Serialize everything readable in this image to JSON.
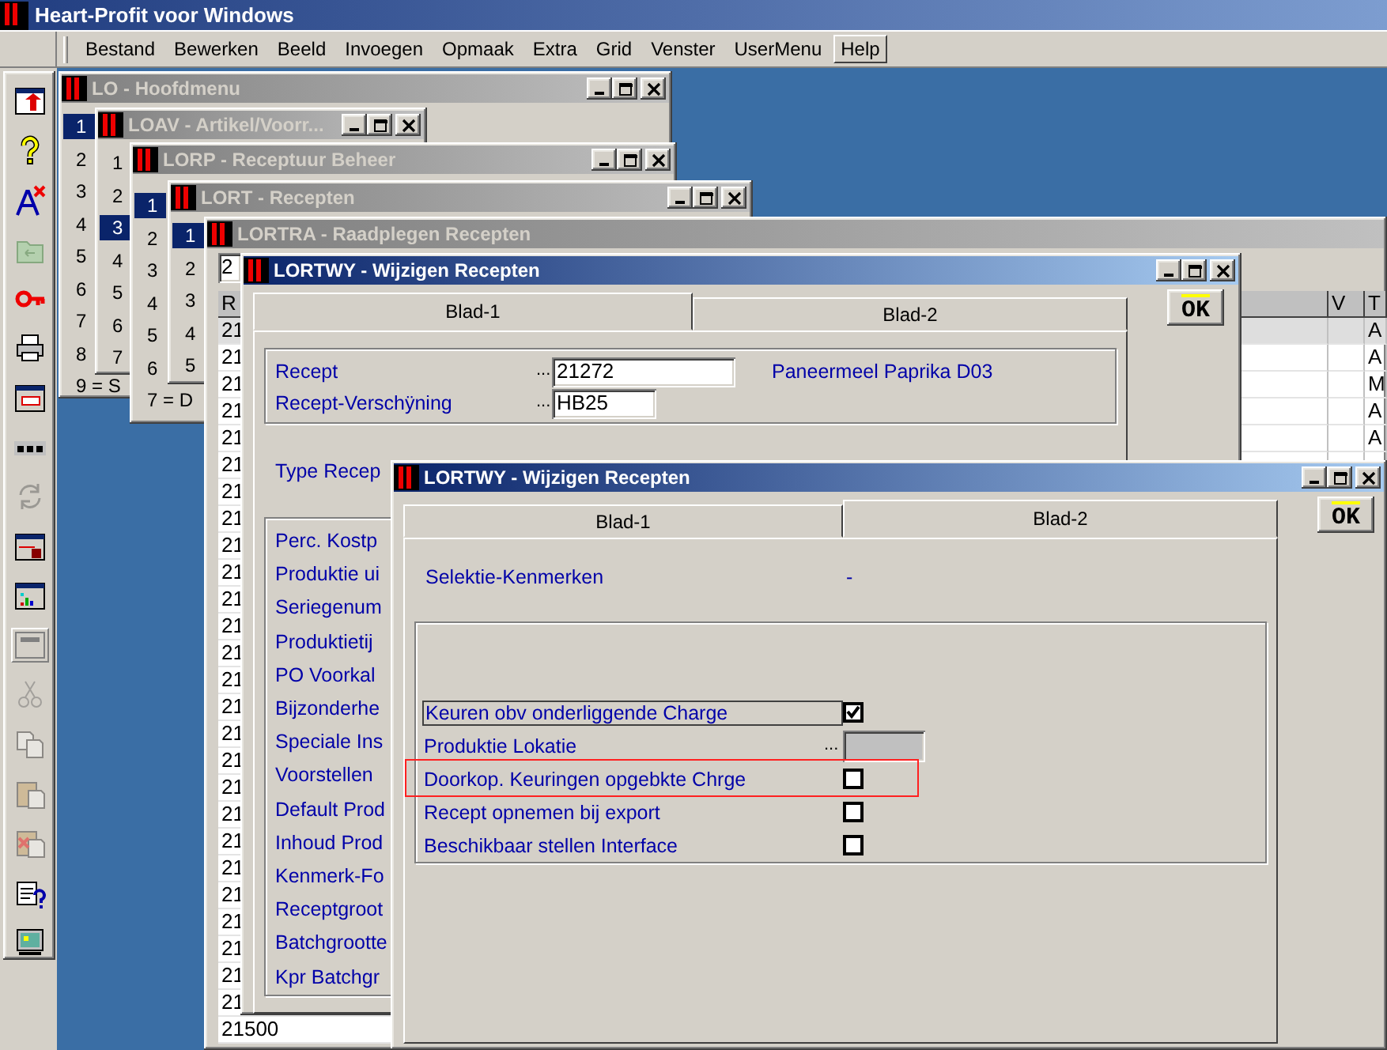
{
  "app_title": "Heart-Profit voor Windows",
  "menu": [
    {
      "label": "Bestand",
      "selected": false
    },
    {
      "label": "Bewerken",
      "selected": false
    },
    {
      "label": "Beeld",
      "selected": false
    },
    {
      "label": "Invoegen",
      "selected": false
    },
    {
      "label": "Opmaak",
      "selected": false
    },
    {
      "label": "Extra",
      "selected": false
    },
    {
      "label": "Grid",
      "selected": false
    },
    {
      "label": "Venster",
      "selected": false
    },
    {
      "label": "UserMenu",
      "selected": false
    },
    {
      "label": "Help",
      "selected": true
    }
  ],
  "toolbar": [
    {
      "disabled": false,
      "pressed": false
    },
    {
      "disabled": false,
      "pressed": false
    },
    {
      "disabled": false,
      "pressed": false
    },
    {
      "disabled": true,
      "pressed": false
    },
    {
      "disabled": false,
      "pressed": false
    },
    {
      "disabled": false,
      "pressed": false
    },
    {
      "disabled": false,
      "pressed": false
    },
    {
      "disabled": false,
      "pressed": false
    },
    {
      "disabled": true,
      "pressed": false
    },
    {
      "disabled": false,
      "pressed": false
    },
    {
      "disabled": false,
      "pressed": false
    },
    {
      "disabled": false,
      "pressed": true
    },
    {
      "disabled": true,
      "pressed": false
    },
    {
      "disabled": true,
      "pressed": false
    },
    {
      "disabled": true,
      "pressed": false
    },
    {
      "disabled": true,
      "pressed": false
    },
    {
      "disabled": false,
      "pressed": false
    },
    {
      "disabled": false,
      "pressed": false
    }
  ],
  "windows": [
    {
      "kind": "list",
      "title": "LO - Hoofdmenu",
      "active": false,
      "title_buttons": true,
      "items": [
        {
          "label": "1",
          "selected": true
        },
        {
          "label": "2",
          "selected": false
        },
        {
          "label": "3",
          "selected": false
        },
        {
          "label": "4",
          "selected": false
        },
        {
          "label": "5",
          "selected": false
        },
        {
          "label": "6",
          "selected": false
        },
        {
          "label": "7",
          "selected": false
        },
        {
          "label": "8",
          "selected": false
        },
        {
          "label": "9 = S",
          "selected": false
        }
      ]
    },
    {
      "kind": "list",
      "title": "LOAV - Artikel/Voorr...",
      "active": false,
      "title_buttons": true,
      "items": [
        {
          "label": "1",
          "selected": false
        },
        {
          "label": "2",
          "selected": false
        },
        {
          "label": "3",
          "selected": true
        },
        {
          "label": "4",
          "selected": false
        },
        {
          "label": "5",
          "selected": false
        },
        {
          "label": "6",
          "selected": false
        },
        {
          "label": "7",
          "selected": false
        }
      ]
    },
    {
      "kind": "list",
      "title": "LORP - Receptuur Beheer",
      "active": false,
      "title_buttons": true,
      "items": [
        {
          "label": "1",
          "selected": true
        },
        {
          "label": "2",
          "selected": false
        },
        {
          "label": "3",
          "selected": false
        },
        {
          "label": "4",
          "selected": false
        },
        {
          "label": "5",
          "selected": false
        },
        {
          "label": "6",
          "selected": false
        },
        {
          "label": "7 = D",
          "selected": false
        }
      ]
    },
    {
      "kind": "list",
      "title": "LORT - Recepten",
      "active": false,
      "title_buttons": true,
      "items": [
        {
          "label": "1",
          "selected": true
        },
        {
          "label": "2",
          "selected": false
        },
        {
          "label": "3",
          "selected": false
        },
        {
          "label": "4",
          "selected": false
        },
        {
          "label": "5",
          "selected": false
        }
      ]
    },
    {
      "kind": "grid",
      "title": "LORTRA - Raadplegen Recepten",
      "active": false,
      "title_buttons": false,
      "field_value": "2",
      "columns": [
        {
          "label": "R"
        },
        {},
        {
          "label": "V"
        },
        {
          "label": "T"
        }
      ],
      "rows": [
        {
          "column_1": "21",
          "column_4": "A",
          "selected": true
        },
        {
          "column_1": "21",
          "column_4": "A",
          "selected": false
        },
        {
          "column_1": "21",
          "column_4": "M",
          "selected": false
        },
        {
          "column_1": "21",
          "column_4": "A",
          "selected": false
        },
        {
          "column_1": "21",
          "column_4": "A",
          "selected": false
        },
        {
          "column_1": "21",
          "selected": false
        },
        {
          "column_1": "21",
          "selected": false
        },
        {
          "column_1": "21",
          "selected": false
        },
        {
          "column_1": "21",
          "selected": false
        },
        {
          "column_1": "21",
          "selected": false
        },
        {
          "column_1": "21",
          "selected": false
        },
        {
          "column_1": "21",
          "selected": false
        },
        {
          "column_1": "21",
          "selected": false
        },
        {
          "column_1": "21",
          "selected": false
        },
        {
          "column_1": "21",
          "selected": false
        },
        {
          "column_1": "21",
          "selected": false
        },
        {
          "column_1": "21",
          "selected": false
        },
        {
          "column_1": "21",
          "selected": false
        },
        {
          "column_1": "21",
          "selected": false
        },
        {
          "column_1": "21",
          "selected": false
        },
        {
          "column_1": "21",
          "selected": false
        },
        {
          "column_1": "21",
          "selected": false
        },
        {
          "column_1": "21",
          "selected": false
        },
        {
          "column_1": "21",
          "selected": false
        },
        {
          "column_1": "21",
          "selected": false
        },
        {
          "column_1": "21",
          "selected": false
        },
        {
          "column_1": "21500",
          "selected": false
        }
      ]
    },
    {
      "kind": "form",
      "title": "LORTWY - Wijzigen Recepten",
      "active": true,
      "title_buttons": true,
      "tabs": [
        {
          "label": "Blad-1",
          "selected": true
        },
        {
          "label": "Blad-2",
          "selected": false
        }
      ],
      "ok_button": "OK",
      "fields": [
        {
          "label": "Recept",
          "prefix": "...",
          "value": "21272",
          "description": "Paneermeel Paprika D03"
        },
        {
          "label": "Recept-Verschÿning",
          "prefix": "...",
          "value": "HB25"
        }
      ],
      "type_label": "Type Recep",
      "labels": [
        "Perc. Kostp",
        "Produktie ui",
        "Seriegenum",
        "Produktietij",
        "PO Voorkal",
        "Bijzonderhe",
        "Speciale Ins",
        "Voorstellen",
        "Default Prod",
        "Inhoud Prod",
        "Kenmerk-Fo",
        "Receptgroot",
        "Batchgrootte",
        "Kpr Batchgr"
      ]
    },
    {
      "kind": "form",
      "title": "LORTWY - Wijzigen Recepten",
      "active": true,
      "title_buttons": true,
      "tabs": [
        {
          "label": "Blad-1",
          "selected": false
        },
        {
          "label": "Blad-2",
          "selected": true
        }
      ],
      "ok_button": "OK",
      "selection": {
        "label": "Selektie-Kenmerken",
        "value": "-"
      },
      "options": [
        {
          "kind": "checkbox",
          "label": "Keuren obv onderliggende Charge",
          "checked": true,
          "focused": true,
          "highlighted": false
        },
        {
          "kind": "field",
          "label": "Produktie Lokatie",
          "prefix": "...",
          "disabled": true,
          "focused": false,
          "highlighted": false
        },
        {
          "kind": "checkbox",
          "label": "Doorkop. Keuringen opgebkte Chrge",
          "checked": false,
          "focused": false,
          "highlighted": true
        },
        {
          "kind": "checkbox",
          "label": "Recept opnemen bij export",
          "checked": false,
          "focused": false,
          "highlighted": false
        },
        {
          "kind": "checkbox",
          "label": "Beschikbaar stellen Interface",
          "checked": false,
          "focused": false,
          "highlighted": false
        }
      ]
    }
  ]
}
